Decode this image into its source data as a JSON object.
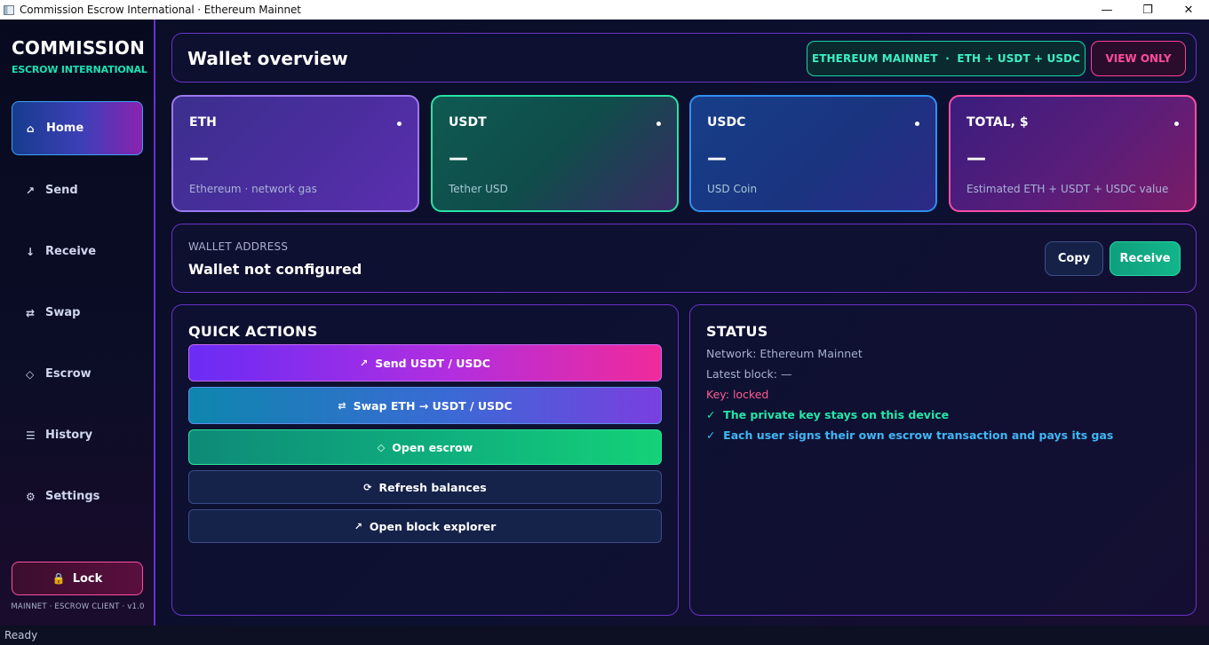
{
  "window": {
    "title": "Commission Escrow International · Ethereum Mainnet",
    "minimize_glyph": "—",
    "maximize_glyph": "❐",
    "close_glyph": "✕"
  },
  "brand": {
    "name": "COMMISSION",
    "subtitle": "ESCROW INTERNATIONAL"
  },
  "sidebar": {
    "items": [
      {
        "label": "Home",
        "icon": "home-icon",
        "glyph": "⌂",
        "active": true
      },
      {
        "label": "Send",
        "icon": "send-arrow-icon",
        "glyph": "↗",
        "active": false
      },
      {
        "label": "Receive",
        "icon": "receive-arrow-icon",
        "glyph": "↓",
        "active": false
      },
      {
        "label": "Swap",
        "icon": "swap-icon",
        "glyph": "⇄",
        "active": false
      },
      {
        "label": "Escrow",
        "icon": "diamond-icon",
        "glyph": "◇",
        "active": false
      },
      {
        "label": "History",
        "icon": "list-icon",
        "glyph": "☰",
        "active": false
      },
      {
        "label": "Settings",
        "icon": "gear-icon",
        "glyph": "⚙",
        "active": false
      }
    ],
    "lock_label": "Lock",
    "lock_glyph": "🔒",
    "version": "MAINNET · ESCROW CLIENT · v1.0"
  },
  "header": {
    "title": "Wallet overview",
    "network_badge": "ETHEREUM MAINNET  ·  ETH + USDT + USDC",
    "mode_badge": "VIEW ONLY"
  },
  "cards": [
    {
      "title": "ETH",
      "value": "—",
      "desc": "Ethereum · network gas"
    },
    {
      "title": "USDT",
      "value": "—",
      "desc": "Tether USD"
    },
    {
      "title": "USDC",
      "value": "—",
      "desc": "USD Coin"
    },
    {
      "title": "TOTAL, $",
      "value": "—",
      "desc": "Estimated ETH + USDT + USDC value"
    }
  ],
  "wallet": {
    "label": "WALLET ADDRESS",
    "value": "Wallet not configured",
    "copy_label": "Copy",
    "receive_label": "Receive"
  },
  "quick_actions": {
    "title": "QUICK ACTIONS",
    "buttons": [
      {
        "label": "Send USDT / USDC",
        "glyph": "↗"
      },
      {
        "label": "Swap ETH → USDT / USDC",
        "glyph": "⇄"
      },
      {
        "label": "Open escrow",
        "glyph": "◇"
      },
      {
        "label": "Refresh balances",
        "glyph": "⟳"
      },
      {
        "label": "Open block explorer",
        "glyph": "↗"
      }
    ]
  },
  "status": {
    "title": "STATUS",
    "network": "Network: Ethereum Mainnet",
    "latest_block": "Latest block: —",
    "key": "Key: locked",
    "note1": "✓  The private key stays on this device",
    "note2": "✓  Each user signs their own escrow transaction and pays its gas"
  },
  "statusbar": {
    "text": "Ready"
  },
  "colors": {
    "accent_teal": "#19e3b0",
    "accent_pink": "#ff4d9a",
    "accent_purple": "#6b2fd6",
    "status_locked": "#ff5c8f",
    "status_ok": "#22e7a8",
    "status_info": "#3fb7f5"
  }
}
